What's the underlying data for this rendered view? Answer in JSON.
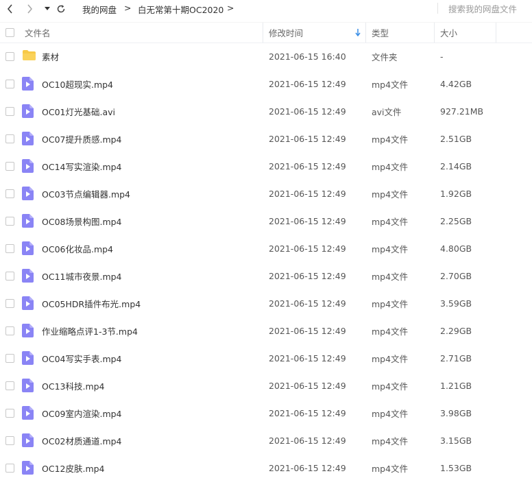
{
  "breadcrumb": [
    "我的网盘",
    "白无常第十期OC2020"
  ],
  "search": {
    "placeholder": "搜索我的网盘文件"
  },
  "columns": {
    "name": "文件名",
    "modified": "修改时间",
    "type": "类型",
    "size": "大小"
  },
  "colors": {
    "folder": "#f7c948",
    "video": "#8a84f5",
    "sort_arrow": "#3a8ee6"
  },
  "files": [
    {
      "name": "素材",
      "modified": "2021-06-15 16:40",
      "type": "文件夹",
      "size": "-",
      "icon": "folder-icon"
    },
    {
      "name": "OC10超现实.mp4",
      "modified": "2021-06-15 12:49",
      "type": "mp4文件",
      "size": "4.42GB",
      "icon": "video-file-icon"
    },
    {
      "name": "OC01灯光基础.avi",
      "modified": "2021-06-15 12:49",
      "type": "avi文件",
      "size": "927.21MB",
      "icon": "video-file-icon"
    },
    {
      "name": "OC07提升质感.mp4",
      "modified": "2021-06-15 12:49",
      "type": "mp4文件",
      "size": "2.51GB",
      "icon": "video-file-icon"
    },
    {
      "name": "OC14写实渲染.mp4",
      "modified": "2021-06-15 12:49",
      "type": "mp4文件",
      "size": "2.14GB",
      "icon": "video-file-icon"
    },
    {
      "name": "OC03节点编辑器.mp4",
      "modified": "2021-06-15 12:49",
      "type": "mp4文件",
      "size": "1.92GB",
      "icon": "video-file-icon"
    },
    {
      "name": "OC08场景构图.mp4",
      "modified": "2021-06-15 12:49",
      "type": "mp4文件",
      "size": "2.25GB",
      "icon": "video-file-icon"
    },
    {
      "name": "OC06化妆品.mp4",
      "modified": "2021-06-15 12:49",
      "type": "mp4文件",
      "size": "4.80GB",
      "icon": "video-file-icon"
    },
    {
      "name": "OC11城市夜景.mp4",
      "modified": "2021-06-15 12:49",
      "type": "mp4文件",
      "size": "2.70GB",
      "icon": "video-file-icon"
    },
    {
      "name": "OC05HDR插件布光.mp4",
      "modified": "2021-06-15 12:49",
      "type": "mp4文件",
      "size": "3.59GB",
      "icon": "video-file-icon"
    },
    {
      "name": "作业缩略点评1-3节.mp4",
      "modified": "2021-06-15 12:49",
      "type": "mp4文件",
      "size": "2.29GB",
      "icon": "video-file-icon"
    },
    {
      "name": "OC04写实手表.mp4",
      "modified": "2021-06-15 12:49",
      "type": "mp4文件",
      "size": "2.71GB",
      "icon": "video-file-icon"
    },
    {
      "name": "OC13科技.mp4",
      "modified": "2021-06-15 12:49",
      "type": "mp4文件",
      "size": "1.21GB",
      "icon": "video-file-icon"
    },
    {
      "name": "OC09室内渲染.mp4",
      "modified": "2021-06-15 12:49",
      "type": "mp4文件",
      "size": "3.98GB",
      "icon": "video-file-icon"
    },
    {
      "name": "OC02材质通道.mp4",
      "modified": "2021-06-15 12:49",
      "type": "mp4文件",
      "size": "3.15GB",
      "icon": "video-file-icon"
    },
    {
      "name": "OC12皮肤.mp4",
      "modified": "2021-06-15 12:49",
      "type": "mp4文件",
      "size": "1.53GB",
      "icon": "video-file-icon"
    }
  ]
}
